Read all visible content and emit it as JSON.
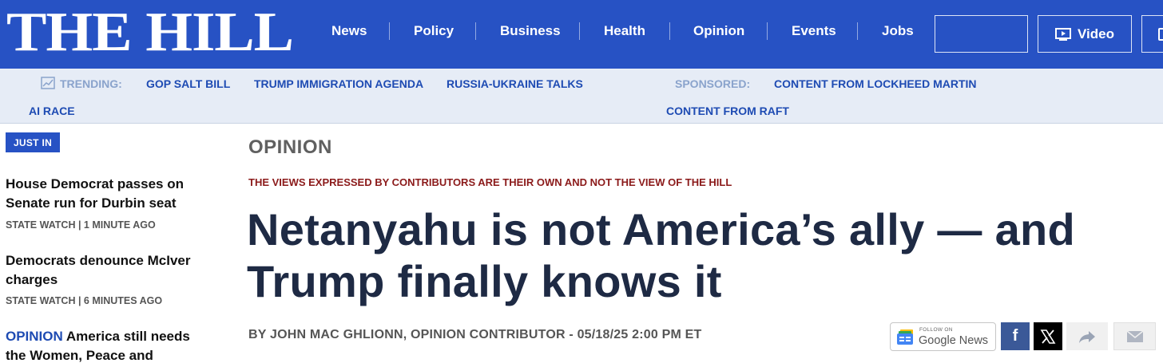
{
  "header": {
    "logo": "THE HILL",
    "nav": [
      "News",
      "Policy",
      "Business",
      "Health",
      "Opinion",
      "Events",
      "Jobs"
    ],
    "search_placeholder": "",
    "video_label": "Video",
    "brand_color": "#2752c4"
  },
  "trending": {
    "label": "TRENDING:",
    "items": [
      "GOP SALT BILL",
      "TRUMP IMMIGRATION AGENDA",
      "RUSSIA-UKRAINE TALKS",
      "AI RACE"
    ],
    "sponsored_label": "SPONSORED:",
    "sponsored_items": [
      "CONTENT FROM LOCKHEED MARTIN",
      "CONTENT FROM RAFT"
    ]
  },
  "sidebar": {
    "badge": "JUST IN",
    "stories": [
      {
        "title": "House Democrat passes on Senate run for Durbin seat",
        "meta": "STATE WATCH | 1 MINUTE AGO"
      },
      {
        "title": "Democrats denounce McIver charges",
        "meta": "STATE WATCH | 6 MINUTES AGO"
      },
      {
        "tag": "OPINION",
        "title": "America still needs the Women, Peace and"
      }
    ]
  },
  "article": {
    "section": "OPINION",
    "disclaimer": "THE VIEWS EXPRESSED BY CONTRIBUTORS ARE THEIR OWN AND NOT THE VIEW OF THE HILL",
    "headline": "Netanyahu is not America’s ally — and Trump finally knows it",
    "byline": "BY JOHN MAC GHLIONN, OPINION CONTRIBUTOR - 05/18/25 2:00 PM ET"
  },
  "share": {
    "gnews_follow": "FOLLOW ON",
    "gnews_label": "Google News",
    "facebook_glyph": "f",
    "icons": [
      "google-news-icon",
      "facebook-icon",
      "x-icon",
      "share-icon",
      "mail-icon"
    ]
  }
}
